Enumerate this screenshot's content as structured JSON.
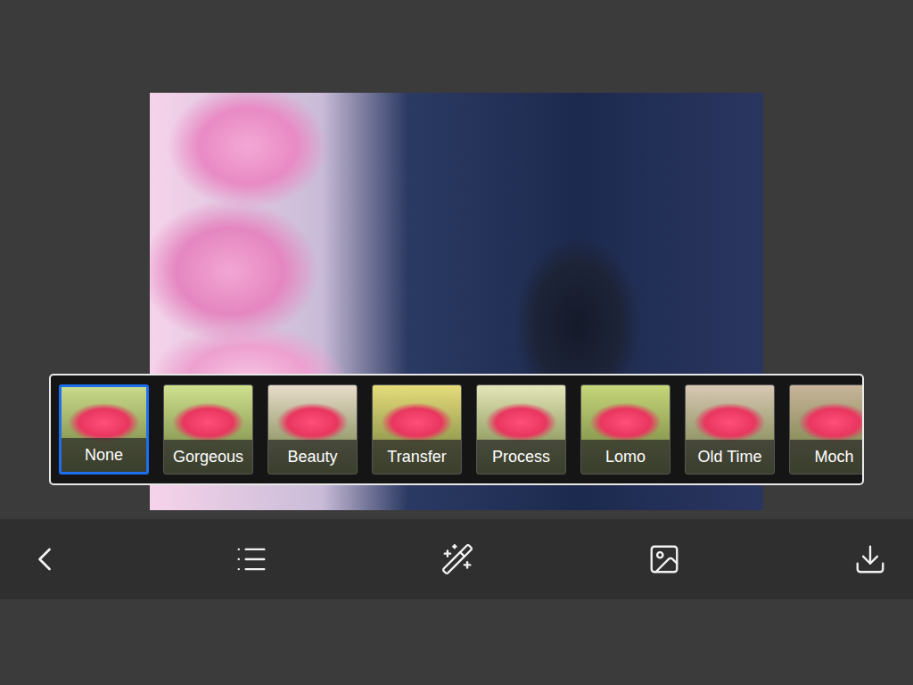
{
  "editor": {
    "photo": {
      "kind": "photo"
    }
  },
  "filters": [
    {
      "label": "None",
      "selected": true,
      "color": "#c9d98a"
    },
    {
      "label": "Gorgeous",
      "selected": false,
      "color": "#cfe08e"
    },
    {
      "label": "Beauty",
      "selected": false,
      "color": "#e8dccb"
    },
    {
      "label": "Transfer",
      "selected": false,
      "color": "#e6dc7a"
    },
    {
      "label": "Process",
      "selected": false,
      "color": "#e4e6b8"
    },
    {
      "label": "Lomo",
      "selected": false,
      "color": "#c6d67a"
    },
    {
      "label": "Old Time",
      "selected": false,
      "color": "#d8c8b4"
    },
    {
      "label": "Moch",
      "selected": false,
      "color": "#c8b49a"
    }
  ],
  "toolbar": [
    {
      "name": "back"
    },
    {
      "name": "list"
    },
    {
      "name": "effects"
    },
    {
      "name": "image"
    },
    {
      "name": "download"
    }
  ]
}
